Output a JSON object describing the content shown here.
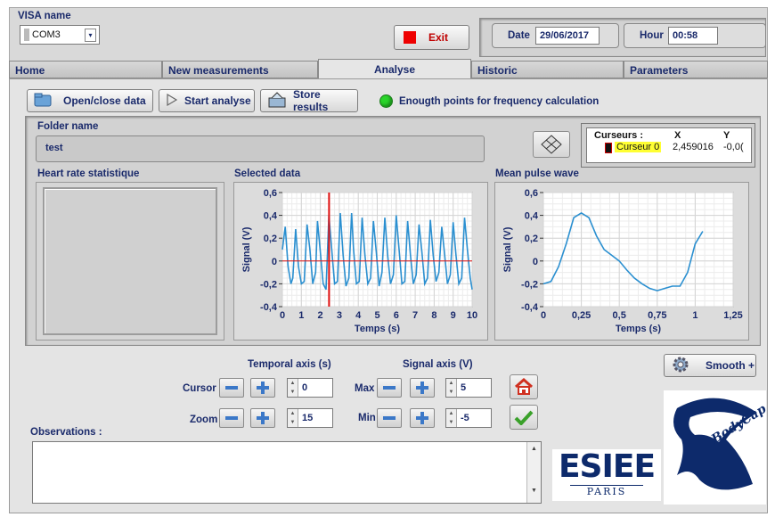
{
  "visa": {
    "label": "VISA name",
    "value": "COM3"
  },
  "exit_label": "Exit",
  "date": {
    "label": "Date",
    "value": "29/06/2017"
  },
  "hour": {
    "label": "Hour",
    "value": "00:58"
  },
  "tabs": [
    "Home",
    "New measurements",
    "Analyse",
    "Historic",
    "Parameters"
  ],
  "toolbar": {
    "open_close": "Open/close data",
    "start_analyse": "Start analyse",
    "store_results": "Store results",
    "indicator_label": "Enougth points for frequency calculation",
    "indicator_color": "#2bd42b"
  },
  "folder": {
    "label": "Folder name",
    "value": "test"
  },
  "cursors": {
    "header": "Curseurs :",
    "col_x": "X",
    "col_y": "Y",
    "name": "Curseur 0",
    "x": "2,459016",
    "y": "-0,0("
  },
  "heart_rate_label": "Heart rate statistique",
  "selected_data_label": "Selected data",
  "mean_pulse_label": "Mean pulse wave",
  "temporal_axis": {
    "title": "Temporal axis (s)",
    "cursor_label": "Cursor",
    "cursor_value": "0",
    "zoom_label": "Zoom",
    "zoom_value": "15"
  },
  "signal_axis": {
    "title": "Signal axis (V)",
    "max_label": "Max",
    "max_value": "5",
    "min_label": "Min",
    "min_value": "-5"
  },
  "smooth_label": "Smooth +",
  "observations_label": "Observations :",
  "logo_esiee": "ESIEE",
  "logo_paris": "PARIS",
  "logo_bodycap": "BodyCap",
  "chart_data": [
    {
      "type": "line",
      "title": "Selected data",
      "xlabel": "Temps (s)",
      "ylabel": "Signal (V)",
      "xlim": [
        0,
        10
      ],
      "ylim": [
        -0.4,
        0.6
      ],
      "xticks": [
        "0",
        "1",
        "2",
        "3",
        "4",
        "5",
        "6",
        "7",
        "8",
        "9",
        "10"
      ],
      "yticks": [
        "-0,4",
        "-0,2",
        "0",
        "0,2",
        "0,4",
        "0,6"
      ],
      "grid": true,
      "cursor_x": 2.459,
      "series": [
        {
          "color": "#2a8fd0",
          "x": [
            0,
            0.15,
            0.3,
            0.45,
            0.55,
            0.7,
            0.85,
            1.0,
            1.15,
            1.3,
            1.45,
            1.6,
            1.75,
            1.85,
            2.0,
            2.15,
            2.3,
            2.45,
            2.6,
            2.75,
            2.9,
            3.05,
            3.2,
            3.35,
            3.5,
            3.65,
            3.75,
            3.9,
            4.05,
            4.2,
            4.35,
            4.5,
            4.65,
            4.8,
            4.95,
            5.1,
            5.25,
            5.4,
            5.55,
            5.7,
            5.85,
            6.0,
            6.15,
            6.3,
            6.45,
            6.6,
            6.75,
            6.9,
            7.05,
            7.2,
            7.35,
            7.5,
            7.65,
            7.8,
            7.95,
            8.1,
            8.25,
            8.4,
            8.55,
            8.7,
            8.85,
            9.0,
            9.15,
            9.3,
            9.45,
            9.6,
            9.75,
            9.9,
            10.0
          ],
          "y": [
            0.1,
            0.3,
            -0.05,
            -0.2,
            -0.15,
            0.28,
            -0.05,
            -0.2,
            -0.18,
            0.32,
            0.1,
            -0.2,
            -0.1,
            0.35,
            0.08,
            -0.2,
            -0.25,
            0.4,
            0.1,
            -0.2,
            -0.18,
            0.42,
            0.05,
            -0.22,
            -0.15,
            0.42,
            0.1,
            -0.2,
            -0.18,
            0.38,
            0.05,
            -0.2,
            -0.15,
            0.35,
            0.08,
            -0.22,
            -0.1,
            0.38,
            0.05,
            -0.2,
            -0.12,
            0.4,
            0.1,
            -0.2,
            -0.18,
            0.35,
            0.05,
            -0.2,
            -0.12,
            0.32,
            0.08,
            -0.2,
            -0.15,
            0.36,
            0.05,
            -0.18,
            -0.1,
            0.3,
            0.06,
            -0.2,
            -0.12,
            0.34,
            0.05,
            -0.2,
            -0.15,
            0.38,
            0.1,
            -0.15,
            -0.25
          ]
        }
      ]
    },
    {
      "type": "line",
      "title": "Mean pulse wave",
      "xlabel": "Temps (s)",
      "ylabel": "Signal (V)",
      "xlim": [
        0,
        1.25
      ],
      "ylim": [
        -0.4,
        0.6
      ],
      "xticks": [
        "0",
        "0,25",
        "0,5",
        "0,75",
        "1",
        "1,25"
      ],
      "yticks": [
        "-0,4",
        "-0,2",
        "0",
        "0,2",
        "0,4",
        "0,6"
      ],
      "grid": true,
      "series": [
        {
          "color": "#2a8fd0",
          "x": [
            0,
            0.05,
            0.1,
            0.15,
            0.2,
            0.25,
            0.3,
            0.35,
            0.4,
            0.45,
            0.5,
            0.55,
            0.6,
            0.65,
            0.7,
            0.75,
            0.8,
            0.85,
            0.9,
            0.95,
            1.0,
            1.05
          ],
          "y": [
            -0.2,
            -0.18,
            -0.05,
            0.15,
            0.38,
            0.42,
            0.38,
            0.22,
            0.1,
            0.05,
            0.0,
            -0.08,
            -0.15,
            -0.2,
            -0.24,
            -0.26,
            -0.24,
            -0.22,
            -0.22,
            -0.1,
            0.15,
            0.26
          ]
        }
      ]
    }
  ]
}
